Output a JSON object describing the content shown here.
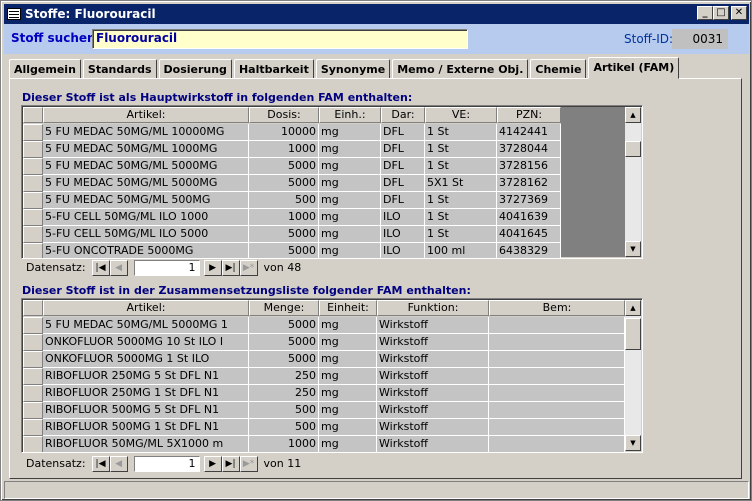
{
  "window": {
    "title": "Stoffe: Fluorouracil",
    "btn_min": "_",
    "btn_max": "□",
    "btn_close": "✕"
  },
  "search": {
    "label": "Stoff suchen:",
    "value": "Fluorouracil",
    "id_label": "Stoff-ID:",
    "id_value": "0031"
  },
  "tabs": [
    "Allgemein",
    "Standards",
    "Dosierung",
    "Haltbarkeit",
    "Synonyme",
    "Memo / Externe Obj.",
    "Chemie",
    "Artikel (FAM)"
  ],
  "active_tab": "Artikel (FAM)",
  "grid1": {
    "title": "Dieser Stoff ist als Hauptwirkstoff in folgenden FAM enthalten:",
    "headers": [
      "Artikel:",
      "Dosis:",
      "Einh.:",
      "Dar:",
      "VE:",
      "PZN:"
    ],
    "rows": [
      [
        "5 FU MEDAC 50MG/ML 10000MG",
        "10000",
        "mg",
        "DFL",
        "1 St",
        "4142441"
      ],
      [
        "5 FU MEDAC 50MG/ML 1000MG",
        "1000",
        "mg",
        "DFL",
        "1 St",
        "3728044"
      ],
      [
        "5 FU MEDAC 50MG/ML 5000MG",
        "5000",
        "mg",
        "DFL",
        "1 St",
        "3728156"
      ],
      [
        "5 FU MEDAC 50MG/ML 5000MG",
        "5000",
        "mg",
        "DFL",
        "5X1 St",
        "3728162"
      ],
      [
        "5 FU MEDAC 50MG/ML 500MG",
        "500",
        "mg",
        "DFL",
        "1 St",
        "3727369"
      ],
      [
        "5-FU CELL 50MG/ML ILO 1000",
        "1000",
        "mg",
        "ILO",
        "1 St",
        "4041639"
      ],
      [
        "5-FU CELL 50MG/ML ILO 5000",
        "5000",
        "mg",
        "ILO",
        "1 St",
        "4041645"
      ],
      [
        "5-FU ONCOTRADE 5000MG",
        "5000",
        "mg",
        "ILO",
        "100 ml",
        "6438329"
      ]
    ],
    "nav": {
      "label": "Datensatz:",
      "current": "1",
      "of": "von 48"
    }
  },
  "grid2": {
    "title": "Dieser Stoff ist in der Zusammensetzungsliste folgender FAM enthalten:",
    "headers": [
      "Artikel:",
      "Menge:",
      "Einheit:",
      "Funktion:",
      "Bem:"
    ],
    "rows": [
      [
        "5 FU MEDAC 50MG/ML 5000MG   1",
        "5000",
        "mg",
        "Wirkstoff",
        ""
      ],
      [
        "ONKOFLUOR 5000MG   10 St ILO I",
        "5000",
        "mg",
        "Wirkstoff",
        ""
      ],
      [
        "ONKOFLUOR 5000MG   1 St ILO",
        "5000",
        "mg",
        "Wirkstoff",
        ""
      ],
      [
        "RIBOFLUOR 250MG   5 St DFL N1",
        "250",
        "mg",
        "Wirkstoff",
        ""
      ],
      [
        "RIBOFLUOR 250MG   1 St DFL N1",
        "250",
        "mg",
        "Wirkstoff",
        ""
      ],
      [
        "RIBOFLUOR 500MG   5 St DFL N1",
        "500",
        "mg",
        "Wirkstoff",
        ""
      ],
      [
        "RIBOFLUOR 500MG   1 St DFL N1",
        "500",
        "mg",
        "Wirkstoff",
        ""
      ],
      [
        "RIBOFLUOR 50MG/ML   5X1000 m",
        "1000",
        "mg",
        "Wirkstoff",
        ""
      ]
    ],
    "nav": {
      "label": "Datensatz:",
      "current": "1",
      "of": "von 11"
    }
  },
  "nav_buttons": {
    "first": "|◀",
    "prev": "◀",
    "next": "▶",
    "last": "▶|",
    "new": "▶*"
  }
}
